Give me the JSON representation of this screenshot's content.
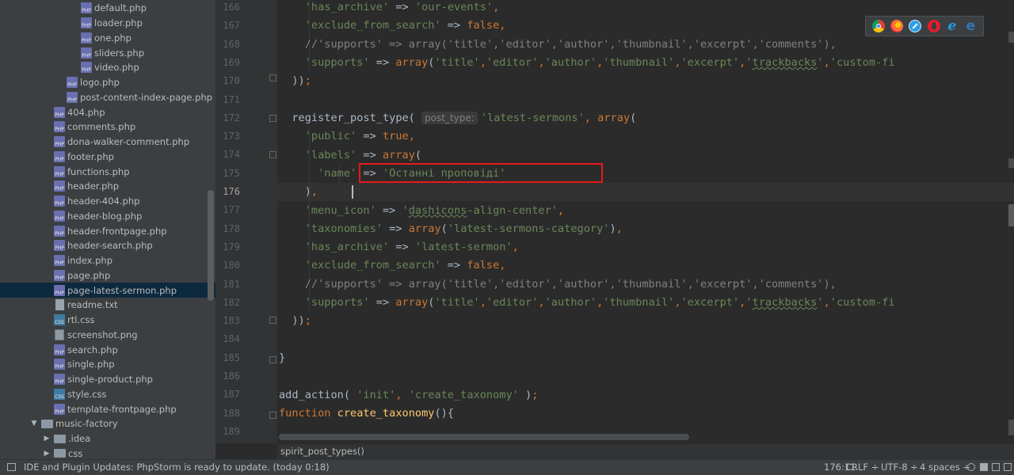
{
  "project_tree": {
    "items": [
      {
        "label": "default.php",
        "type": "php"
      },
      {
        "label": "loader.php",
        "type": "php"
      },
      {
        "label": "one.php",
        "type": "php"
      },
      {
        "label": "sliders.php",
        "type": "php"
      },
      {
        "label": "video.php",
        "type": "php"
      },
      {
        "label": "logo.php",
        "type": "php"
      },
      {
        "label": "post-content-index-page.php",
        "type": "php"
      },
      {
        "label": "404.php",
        "type": "php"
      },
      {
        "label": "comments.php",
        "type": "php"
      },
      {
        "label": "dona-walker-comment.php",
        "type": "php"
      },
      {
        "label": "footer.php",
        "type": "php"
      },
      {
        "label": "functions.php",
        "type": "php"
      },
      {
        "label": "header.php",
        "type": "php"
      },
      {
        "label": "header-404.php",
        "type": "php"
      },
      {
        "label": "header-blog.php",
        "type": "php"
      },
      {
        "label": "header-frontpage.php",
        "type": "php"
      },
      {
        "label": "header-search.php",
        "type": "php"
      },
      {
        "label": "index.php",
        "type": "php"
      },
      {
        "label": "page.php",
        "type": "php"
      },
      {
        "label": "page-latest-sermon.php",
        "type": "php",
        "selected": true
      },
      {
        "label": "readme.txt",
        "type": "txt"
      },
      {
        "label": "rtl.css",
        "type": "css"
      },
      {
        "label": "screenshot.png",
        "type": "png"
      },
      {
        "label": "search.php",
        "type": "php"
      },
      {
        "label": "single.php",
        "type": "php"
      },
      {
        "label": "single-product.php",
        "type": "php"
      },
      {
        "label": "style.css",
        "type": "css"
      },
      {
        "label": "template-frontpage.php",
        "type": "php"
      },
      {
        "label": "music-factory",
        "type": "folder",
        "expanded": true
      },
      {
        "label": ".idea",
        "type": "folder",
        "expanded": false
      },
      {
        "label": "css",
        "type": "folder",
        "expanded": false
      }
    ]
  },
  "editor": {
    "current_line": "176",
    "param_hint": "post_type:",
    "lines": [
      {
        "num": "166",
        "text": "'has_archive' => 'our-events',"
      },
      {
        "num": "167",
        "text": "'exclude_from_search' => false,"
      },
      {
        "num": "168",
        "text": "//'supports' => array('title','editor','author','thumbnail','excerpt','comments'),"
      },
      {
        "num": "169",
        "text": "'supports' => array('title','editor','author','thumbnail','excerpt','trackbacks','custom-fi"
      },
      {
        "num": "170",
        "text": "));"
      },
      {
        "num": "171",
        "text": ""
      },
      {
        "num": "172",
        "text": "register_post_type( 'latest-sermons', array("
      },
      {
        "num": "173",
        "text": "'public' => true,"
      },
      {
        "num": "174",
        "text": "'labels' => array("
      },
      {
        "num": "175",
        "text": "'name' => 'Останні проповіді'"
      },
      {
        "num": "176",
        "text": "),"
      },
      {
        "num": "177",
        "text": "'menu_icon' => 'dashicons-align-center',"
      },
      {
        "num": "178",
        "text": "'taxonomies' => array('latest-sermons-category'),"
      },
      {
        "num": "179",
        "text": "'has_archive' => 'latest-sermon',"
      },
      {
        "num": "180",
        "text": "'exclude_from_search' => false,"
      },
      {
        "num": "181",
        "text": "//'supports' => array('title','editor','author','thumbnail','excerpt','comments'),"
      },
      {
        "num": "182",
        "text": "'supports' => array('title','editor','author','thumbnail','excerpt','trackbacks','custom-fi"
      },
      {
        "num": "183",
        "text": "));"
      },
      {
        "num": "184",
        "text": ""
      },
      {
        "num": "185",
        "text": "}"
      },
      {
        "num": "186",
        "text": ""
      },
      {
        "num": "187",
        "text": "add_action( 'init', 'create_taxonomy' );"
      },
      {
        "num": "188",
        "text": "function create_taxonomy(){"
      },
      {
        "num": "189",
        "text": ""
      }
    ]
  },
  "browser_icons": [
    "chrome-icon",
    "firefox-icon",
    "safari-icon",
    "opera-icon",
    "ie-icon",
    "edge-icon"
  ],
  "breadcrumb": "spirit_post_types()",
  "status": {
    "message": "IDE and Plugin Updates: PhpStorm is ready to update. (today 0:18)",
    "position": "176:11",
    "line_sep": "CRLF ÷",
    "encoding": "UTF-8 ÷",
    "indent": "4 spaces ÷"
  },
  "colors": {
    "highlight_box": "#e81919",
    "string": "#6a8759",
    "keyword": "#cc7832",
    "comment": "#808080",
    "function_decl": "#ffc66d"
  }
}
